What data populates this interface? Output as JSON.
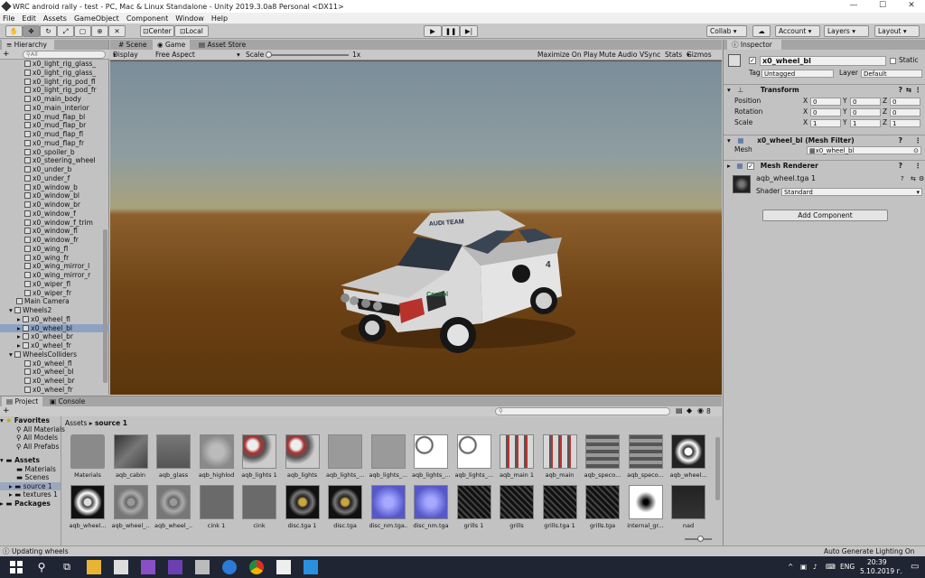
{
  "window": {
    "title": "WRC android rally - test - PC, Mac & Linux Standalone - Unity 2019.3.0a8 Personal <DX11>",
    "minimize": "—",
    "maximize": "☐",
    "close": "✕"
  },
  "menu": [
    "File",
    "Edit",
    "Assets",
    "GameObject",
    "Component",
    "Window",
    "Help"
  ],
  "toolbar": {
    "center_label": "Center",
    "local_label": "Local",
    "collab_label": "Collab",
    "account_label": "Account",
    "layers_label": "Layers",
    "layout_label": "Layout"
  },
  "hierarchy": {
    "tab": "Hierarchy",
    "create_label": "+",
    "search_placeholder": "All",
    "items": [
      {
        "label": "x0_light_rig_glass_",
        "indent": 3
      },
      {
        "label": "x0_light_rig_glass_",
        "indent": 3
      },
      {
        "label": "x0_light_rig_pod_fl",
        "indent": 3
      },
      {
        "label": "x0_light_rig_pod_fr",
        "indent": 3
      },
      {
        "label": "x0_main_body",
        "indent": 3
      },
      {
        "label": "x0_main_interior",
        "indent": 3
      },
      {
        "label": "x0_mud_flap_bl",
        "indent": 3
      },
      {
        "label": "x0_mud_flap_br",
        "indent": 3
      },
      {
        "label": "x0_mud_flap_fl",
        "indent": 3
      },
      {
        "label": "x0_mud_flap_fr",
        "indent": 3
      },
      {
        "label": "x0_spoiler_b",
        "indent": 3
      },
      {
        "label": "x0_steering_wheel",
        "indent": 3
      },
      {
        "label": "x0_under_b",
        "indent": 3
      },
      {
        "label": "x0_under_f",
        "indent": 3
      },
      {
        "label": "x0_window_b",
        "indent": 3
      },
      {
        "label": "x0_window_bl",
        "indent": 3
      },
      {
        "label": "x0_window_br",
        "indent": 3
      },
      {
        "label": "x0_window_f",
        "indent": 3
      },
      {
        "label": "x0_window_f_trim",
        "indent": 3
      },
      {
        "label": "x0_window_fl",
        "indent": 3
      },
      {
        "label": "x0_window_fr",
        "indent": 3
      },
      {
        "label": "x0_wing_fl",
        "indent": 3
      },
      {
        "label": "x0_wing_fr",
        "indent": 3
      },
      {
        "label": "x0_wing_mirror_l",
        "indent": 3
      },
      {
        "label": "x0_wing_mirror_r",
        "indent": 3
      },
      {
        "label": "x0_wiper_fl",
        "indent": 3
      },
      {
        "label": "x0_wiper_fr",
        "indent": 3
      },
      {
        "label": "Main Camera",
        "indent": 2
      },
      {
        "label": "Wheels2",
        "indent": 2,
        "expanded": true
      },
      {
        "label": "x0_wheel_fl",
        "indent": 3,
        "arrow": true
      },
      {
        "label": "x0_wheel_bl",
        "indent": 3,
        "arrow": true,
        "selected": true
      },
      {
        "label": "x0_wheel_br",
        "indent": 3,
        "arrow": true
      },
      {
        "label": "x0_wheel_fr",
        "indent": 3,
        "arrow": true
      },
      {
        "label": "WheelsColliders",
        "indent": 2,
        "expanded": true
      },
      {
        "label": "x0_wheel_fl",
        "indent": 3
      },
      {
        "label": "x0_wheel_bl",
        "indent": 3
      },
      {
        "label": "x0_wheel_br",
        "indent": 3
      },
      {
        "label": "x0_wheel_fr",
        "indent": 3
      }
    ]
  },
  "scene": {
    "tabs": [
      "Scene",
      "Game",
      "Asset Store"
    ],
    "display": "Display 1",
    "aspect": "Free Aspect",
    "scale_label": "Scale",
    "scale_value": "1x",
    "options": [
      "Maximize On Play",
      "Mute Audio",
      "VSync",
      "Stats",
      "Gizmos"
    ],
    "car_text": {
      "team": "AUDI TEAM",
      "sponsor": "Castrol",
      "number": "4"
    }
  },
  "inspector": {
    "tab": "Inspector",
    "object_name": "x0_wheel_bl",
    "static_label": "Static",
    "tag_label": "Tag",
    "tag_value": "Untagged",
    "layer_label": "Layer",
    "layer_value": "Default",
    "transform": {
      "title": "Transform",
      "rows": [
        {
          "label": "Position",
          "x": "0",
          "y": "0",
          "z": "0"
        },
        {
          "label": "Rotation",
          "x": "0",
          "y": "0",
          "z": "0"
        },
        {
          "label": "Scale",
          "x": "1",
          "y": "1",
          "z": "1"
        }
      ]
    },
    "mesh_filter": {
      "title": "x0_wheel_bl (Mesh Filter)",
      "mesh_label": "Mesh",
      "mesh_value": "x0_wheel_bl"
    },
    "mesh_renderer": {
      "title": "Mesh Renderer"
    },
    "material": {
      "name": "aqb_wheel.tga 1",
      "shader_label": "Shader",
      "shader_value": "Standard"
    },
    "add_component": "Add Component"
  },
  "project": {
    "tabs": [
      "Project",
      "Console"
    ],
    "favorites_label": "Favorites",
    "favorites": [
      "All Materials",
      "All Models",
      "All Prefabs"
    ],
    "assets_label": "Assets",
    "assets_children": [
      "Materials",
      "Scenes",
      "source 1",
      "textures 1"
    ],
    "packages_label": "Packages",
    "breadcrumb": [
      "Assets",
      "source 1"
    ],
    "hidden_count": "8",
    "row1": [
      {
        "name": "Materials",
        "kind": "folder"
      },
      {
        "name": "aqb_cabin",
        "kind": "cabin"
      },
      {
        "name": "aqb_glass",
        "kind": "glass"
      },
      {
        "name": "aqb_highlod",
        "kind": "model"
      },
      {
        "name": "aqb_lights 1",
        "kind": "lights"
      },
      {
        "name": "aqb_lights",
        "kind": "lights"
      },
      {
        "name": "aqb_lights_...",
        "kind": "flat"
      },
      {
        "name": "aqb_lights_...",
        "kind": "flat"
      },
      {
        "name": "aqb_lights_...",
        "kind": "white"
      },
      {
        "name": "aqb_lights_...",
        "kind": "white"
      },
      {
        "name": "aqb_main 1",
        "kind": "main"
      },
      {
        "name": "aqb_main",
        "kind": "main"
      },
      {
        "name": "aqb_speco...",
        "kind": "spec"
      },
      {
        "name": "aqb_speco...",
        "kind": "spec"
      },
      {
        "name": "aqb_wheel...",
        "kind": "wheel"
      }
    ],
    "row2": [
      {
        "name": "aqb_wheel...",
        "kind": "wheelwhite"
      },
      {
        "name": "aqb_wheel_...",
        "kind": "wheelgrey"
      },
      {
        "name": "aqb_wheel_...",
        "kind": "wheelgrey"
      },
      {
        "name": "cink 1",
        "kind": "cink"
      },
      {
        "name": "cink",
        "kind": "cink"
      },
      {
        "name": "disc.tga 1",
        "kind": "disc"
      },
      {
        "name": "disc.tga",
        "kind": "disc"
      },
      {
        "name": "disc_nm.tga...",
        "kind": "discnm"
      },
      {
        "name": "disc_nm.tga",
        "kind": "discnm"
      },
      {
        "name": "grills 1",
        "kind": "grill"
      },
      {
        "name": "grills",
        "kind": "grill"
      },
      {
        "name": "grills.tga 1",
        "kind": "grill"
      },
      {
        "name": "grills.tga",
        "kind": "grill"
      },
      {
        "name": "internal_gr...",
        "kind": "internal"
      },
      {
        "name": "nad",
        "kind": "nad"
      }
    ]
  },
  "status": {
    "message": "Updating wheels",
    "lighting": "Auto Generate Lighting On"
  },
  "taskbar": {
    "lang": "ENG",
    "time": "20:39",
    "date": "5.10.2019 г."
  }
}
